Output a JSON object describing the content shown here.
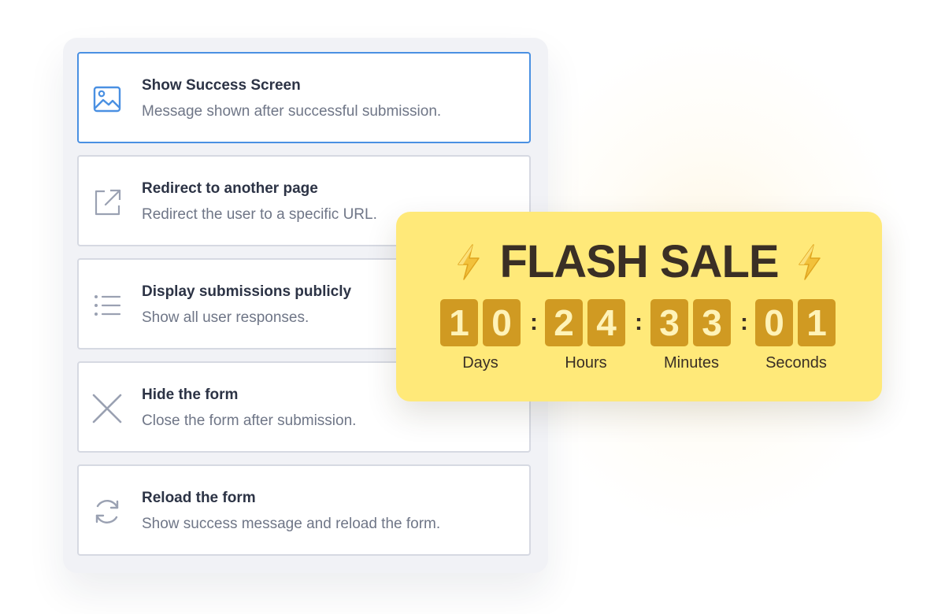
{
  "options": [
    {
      "icon": "image-icon",
      "title": "Show Success Screen",
      "description": "Message shown after successful submission.",
      "selected": true
    },
    {
      "icon": "external-link-icon",
      "title": "Redirect to another page",
      "description": "Redirect the user to a specific URL.",
      "selected": false
    },
    {
      "icon": "list-icon",
      "title": "Display submissions publicly",
      "description": "Show all user responses.",
      "selected": false
    },
    {
      "icon": "close-icon",
      "title": "Hide the form",
      "description": "Close the form after submission.",
      "selected": false
    },
    {
      "icon": "reload-icon",
      "title": "Reload the form",
      "description": "Show success message and reload the form.",
      "selected": false
    }
  ],
  "flash_sale": {
    "title": "FLASH SALE",
    "icon": "lightning-bolt-icon",
    "countdown": {
      "days": {
        "digits": [
          "1",
          "0"
        ],
        "label": "Days"
      },
      "hours": {
        "digits": [
          "2",
          "4"
        ],
        "label": "Hours"
      },
      "minutes": {
        "digits": [
          "3",
          "3"
        ],
        "label": "Minutes"
      },
      "seconds": {
        "digits": [
          "0",
          "1"
        ],
        "label": "Seconds"
      }
    },
    "separator": ":"
  },
  "colors": {
    "selected_border": "#4a90e2",
    "sale_background": "#ffe979",
    "digit_background": "#d09a22",
    "digit_text": "#fff3b8",
    "text_dark": "#3a2f25"
  }
}
